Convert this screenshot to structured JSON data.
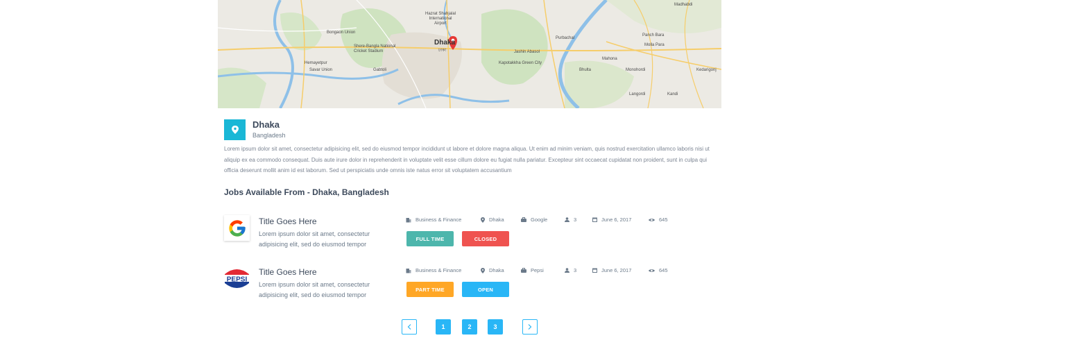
{
  "map": {
    "pin_city": "Dhaka",
    "pin_city_local": "ঢাকা",
    "labels": [
      "Madhabdi",
      "Hazrat Shahjalal International Airport",
      "Bongaon Union",
      "Shere-Bangla National Cricket Stadium",
      "Hemayetpur",
      "Savar Union",
      "Gabtoli",
      "Jashin Abasol",
      "Kapotakkha Green City",
      "Purbachal",
      "Panch Bara",
      "Molla Para",
      "Mahona",
      "Bhulta",
      "Monohordi",
      "Langordi",
      "Kandi",
      "Kedarigonj"
    ]
  },
  "location": {
    "icon": "map-marker-icon",
    "city": "Dhaka",
    "country": "Bangladesh",
    "description": "Lorem ipsum dolor sit amet, consectetur adipisicing elit, sed do eiusmod tempor incididunt ut labore et dolore magna aliqua. Ut enim ad minim veniam, quis nostrud exercitation ullamco laboris nisi ut aliquip ex ea commodo consequat. Duis aute irure dolor in reprehenderit in voluptate velit esse cillum dolore eu fugiat nulla pariatur. Excepteur sint occaecat cupidatat non proident, sunt in culpa qui officia deserunt mollit anim id est laborum. Sed ut perspiciatis unde omnis iste natus error sit voluptatem accusantium"
  },
  "jobs_section": {
    "title": "Jobs Available From - Dhaka, Bangladesh"
  },
  "jobs": [
    {
      "logo": "google-logo",
      "title": "Title Goes Here",
      "description": "Lorem ipsum dolor sit amet, consectetur adipisicing elit, sed do eiusmod tempor",
      "category": "Business & Finance",
      "location": "Dhaka",
      "company": "Google",
      "vacancies": "3",
      "date": "June 6, 2017",
      "views": "645",
      "type": "FULL TIME",
      "status": "CLOSED",
      "type_color": "#4db6ac",
      "status_color": "#ef5350"
    },
    {
      "logo": "pepsi-logo",
      "title": "Title Goes Here",
      "description": "Lorem ipsum dolor sit amet, consectetur adipisicing elit, sed do eiusmod tempor",
      "category": "Business & Finance",
      "location": "Dhaka",
      "company": "Pepsi",
      "vacancies": "3",
      "date": "June 6, 2017",
      "views": "645",
      "type": "PART TIME",
      "status": "OPEN",
      "type_color": "#ffa726",
      "status_color": "#29b6f6"
    }
  ],
  "pagination": {
    "prev_icon": "chevron-left-icon",
    "next_icon": "chevron-right-icon",
    "pages": [
      "1",
      "2",
      "3"
    ]
  },
  "colors": {
    "accent": "#29b6f6",
    "location_badge": "#1ab7d6",
    "text": "#3d4a5c"
  }
}
